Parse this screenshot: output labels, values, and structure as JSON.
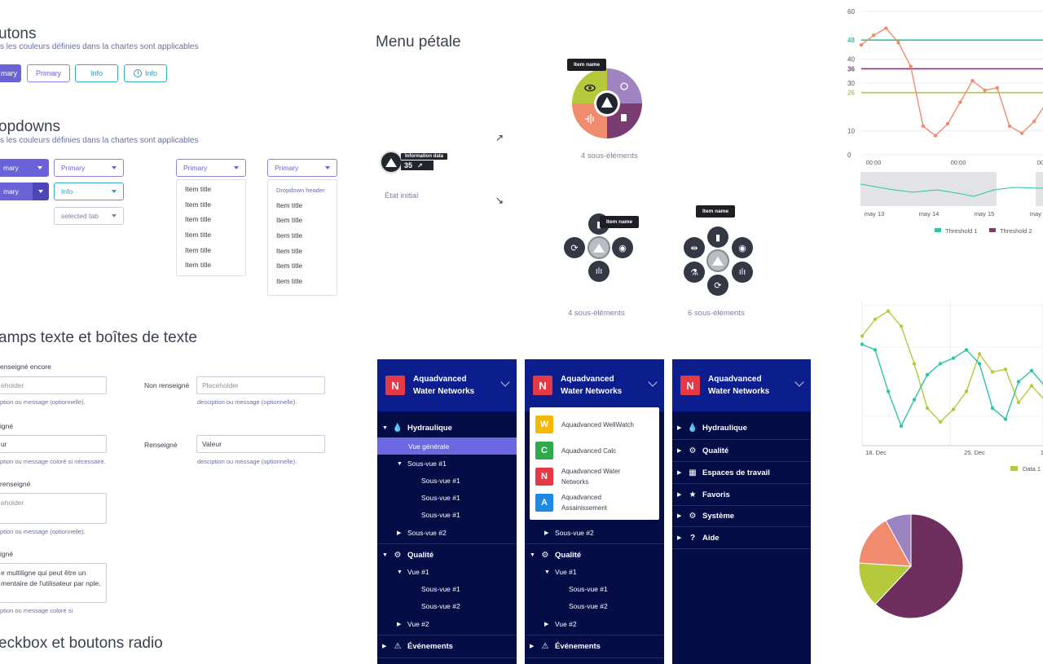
{
  "buttons": {
    "title": "utons",
    "subtitle": "s les couleurs définies dans la chartes sont applicables",
    "primary_filled": "mary",
    "primary_outline": "Primary",
    "info_outline": "Info",
    "info_icon": "Info"
  },
  "dropdowns": {
    "title": "opdowns",
    "subtitle": "s les couleurs définies dans la chartes sont applicables",
    "split1": "mary",
    "split2": "mary",
    "primary_outline": "Primary",
    "info_outline": "Info",
    "selected_tab": "selected tab",
    "menu1_label": "Primary",
    "menu1_items": [
      "Item title",
      "Item title",
      "Item title",
      "Item title",
      "Item title",
      "Item title"
    ],
    "menu2_label": "Primary",
    "menu2_header": "Dropdown header",
    "menu2_items": [
      "Item title",
      "Item title",
      "Item title",
      "Item title",
      "Item title",
      "Item title"
    ]
  },
  "textfields": {
    "title": "amps texte et boîtes de texte",
    "l1": "enseigné encore",
    "p1": "eholder",
    "h1": "ption ou message (optionnelle).",
    "l2": "Non renseigné",
    "p2": "Placeholder",
    "h2": "desciption ou message (optionnelle).",
    "l3": "igné",
    "v3": "ur",
    "h3": "ption ou message coloré si nécessaire.",
    "l4": "Renseigné",
    "v4": "Valeur",
    "h4": "desciption ou message (optionnelle).",
    "l5": "renseigné",
    "p5": "eholder",
    "h5": "ption ou message (optionnelle).",
    "l6": "igné",
    "v6": "e multiligne qui peut être un mentaire de l'utilisateur par nple.",
    "h6": "ption ou message coloré si"
  },
  "checkbox_title": "eckbox et boutons radio",
  "petal": {
    "title": "Menu pétale",
    "tip_top": "Item name",
    "cap_top": "4 sous-éléments",
    "info_label": "Information data",
    "info_value": "35",
    "initial_state": "État initial",
    "tip_left": "Item name",
    "cap_left": "4 sous-éléments",
    "tip_right": "Item name",
    "cap_right": "6 sous-éléments"
  },
  "sidebar": {
    "logo": "N",
    "app_line1": "Aquadvanced",
    "app_line2": "Water Networks",
    "p1": {
      "hydraulique": "Hydraulique",
      "vue_generale": "Vue générale",
      "sousvue1": "Sous-vue #1",
      "sub1": "Sous-vue #1",
      "sub2": "Sous-vue #1",
      "sub3": "Sous-vue #1",
      "sousvue2": "Sous-vue #2",
      "qualite": "Qualité",
      "vue1": "Vue #1",
      "q_sub1": "Sous-vue #1",
      "q_sub2": "Sous-vue #2",
      "vue2": "Vue #2",
      "evenements": "Événements"
    },
    "p2": {
      "apps": [
        {
          "letter": "W",
          "name": "Aquadvanced WellWatch",
          "color": "#f5b800"
        },
        {
          "letter": "C",
          "name": "Aquadvanced Calc",
          "color": "#2eaa4a"
        },
        {
          "letter": "N",
          "name": "Aquadvanced Water Networks",
          "color": "#e63946"
        },
        {
          "letter": "A",
          "name": "Aquadvanced Assainissement",
          "color": "#1e88e5"
        }
      ],
      "sousvue2": "Sous-vue #2",
      "qualite": "Qualité",
      "vue1": "Vue #1",
      "q_sub1": "Sous-vue #1",
      "q_sub2": "Sous-vue #2",
      "vue2": "Vue #2",
      "evenements": "Événements"
    },
    "p3": {
      "items": [
        "Hydraulique",
        "Qualité",
        "Espaces de travail",
        "Favoris",
        "Système",
        "Aide"
      ]
    }
  },
  "chart_data": [
    {
      "type": "line",
      "yticks": [
        "60",
        "48",
        "40",
        "36",
        "30",
        "26",
        "10",
        "0"
      ],
      "x_ticks": [
        "00:00",
        "00:00",
        "00:2"
      ],
      "series": [
        {
          "color": "#f08b6e",
          "values": [
            46,
            50,
            53,
            47,
            37,
            12,
            8,
            13,
            22,
            31,
            27,
            28,
            12,
            9,
            14,
            22
          ]
        }
      ],
      "thresholds": [
        {
          "name": "Threshold 1",
          "value": 48,
          "color": "#2ec4a8"
        },
        {
          "name": "Threshold 2",
          "value": 36,
          "color": "#7a3b72"
        },
        {
          "name": "",
          "value": 26,
          "color": "#b5c93a"
        }
      ],
      "navigator_ticks": [
        "may 13",
        "may 14",
        "may 15",
        "may 1"
      ],
      "legend": [
        "Threshold 1",
        "Threshold 2"
      ]
    },
    {
      "type": "line",
      "x_ticks": [
        "18. Dec",
        "25. Dec",
        "1. 2"
      ],
      "series": [
        {
          "name": "Data 1",
          "color": "#b5c93a",
          "values": [
            58,
            70,
            76,
            65,
            38,
            6,
            -4,
            5,
            18,
            45,
            32,
            34,
            10,
            22,
            12
          ]
        },
        {
          "color": "#2ec4a8",
          "values": [
            52,
            48,
            18,
            -7,
            12,
            30,
            38,
            42,
            48,
            38,
            6,
            -2,
            25,
            33,
            22
          ]
        }
      ],
      "legend": [
        "Data 1"
      ]
    },
    {
      "type": "pie",
      "slices": [
        {
          "value": 62,
          "color": "#6f2f5e"
        },
        {
          "value": 14,
          "color": "#b5c93a"
        },
        {
          "value": 16,
          "color": "#f08b6e"
        },
        {
          "value": 8,
          "color": "#9b84c0"
        }
      ]
    }
  ]
}
